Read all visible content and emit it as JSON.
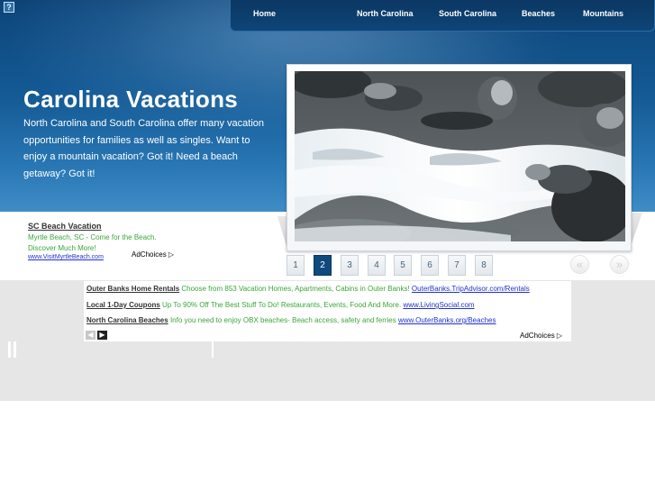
{
  "header": {
    "help_icon": "?",
    "nav": [
      "Home",
      "North Carolina",
      "South Carolina",
      "Beaches",
      "Mountains"
    ]
  },
  "hero": {
    "title": "Carolina Vacations",
    "intro": "North Carolina and South Carolina offer many vacation opportunities for families as well as singles. Want to enjoy a mountain vacation? Got it! Need a beach getaway? Got it!"
  },
  "slideshow": {
    "pages": [
      "1",
      "2",
      "3",
      "4",
      "5",
      "6",
      "7",
      "8"
    ],
    "active_page": "2",
    "prev_label": "«",
    "next_label": "»"
  },
  "side_ad": {
    "title": "SC Beach Vacation",
    "text": "Myrtle Beach, SC - Come for the Beach. Discover Much More!",
    "url": "www.VisitMyrtleBeach.com",
    "adchoices": "AdChoices"
  },
  "ad_box": {
    "rows": [
      {
        "title": "Outer Banks Home Rentals",
        "desc": "Choose from 853 Vacation Homes, Apartments, Cabins in Outer Banks!",
        "url": "OuterBanks.TripAdvisor.com/Rentals"
      },
      {
        "title": "Local 1-Day Coupons",
        "desc": "Up To 90% Off The Best Stuff To Do! Restaurants, Events, Food And More.",
        "url": "www.LivingSocial.com"
      },
      {
        "title": "North Carolina Beaches",
        "desc": "Info you need to enjoy OBX beaches- Beach access, safety and ferries",
        "url": "www.OuterBanks.org/Beaches"
      }
    ],
    "adchoices": "AdChoices"
  },
  "colors": {
    "header_blue": "#145a95",
    "nav_dark": "#0b3763",
    "active_page": "#0f4a7f",
    "ad_green": "#3aa63a",
    "ad_link": "#1f33cc",
    "grey_band": "#e6e6e6"
  }
}
